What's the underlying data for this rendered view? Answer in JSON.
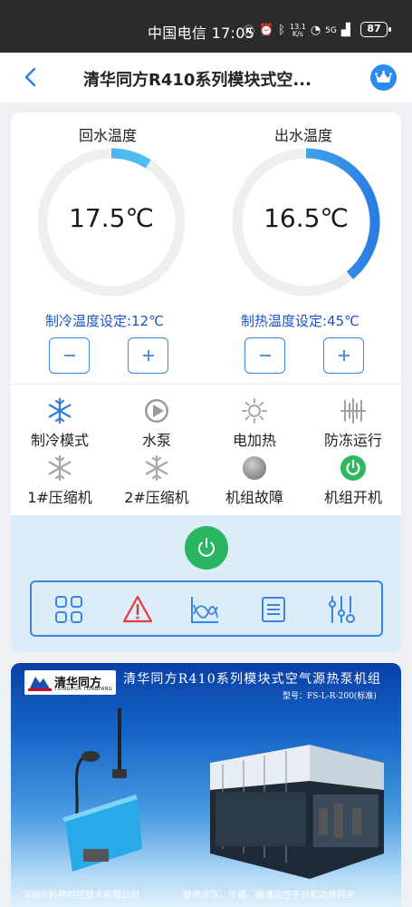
{
  "status_bar": {
    "carrier_time": "中国电信 17:05",
    "net_speed_top": "13.1",
    "net_speed_bottom": "K/s",
    "signal": "5G",
    "battery": "87"
  },
  "nav": {
    "title": "清华同方R410系列模块式空..."
  },
  "gauges": [
    {
      "label": "回水温度",
      "value": "17.5℃",
      "fill_fraction": 0.09
    },
    {
      "label": "出水温度",
      "value": "16.5℃",
      "fill_fraction": 0.39
    }
  ],
  "setpoints": {
    "cooling": "制冷温度设定:12℃",
    "heating": "制热温度设定:45℃"
  },
  "status_items": [
    {
      "label": "制冷模式",
      "icon": "snowflake-icon",
      "active": true
    },
    {
      "label": "水泵",
      "icon": "pump-icon",
      "active": false
    },
    {
      "label": "电加热",
      "icon": "heater-icon",
      "active": false
    },
    {
      "label": "防冻运行",
      "icon": "antifreeze-icon",
      "active": false
    },
    {
      "label": "1#压缩机",
      "icon": "compressor-icon",
      "active": false
    },
    {
      "label": "2#压缩机",
      "icon": "compressor-icon",
      "active": false
    },
    {
      "label": "机组故障",
      "icon": "fault-icon",
      "active": false
    },
    {
      "label": "机组开机",
      "icon": "power-on-icon",
      "active": true
    }
  ],
  "toolbar_icons": [
    "grid-icon",
    "alarm-icon",
    "chart-icon",
    "list-icon",
    "settings-icon"
  ],
  "colors": {
    "accent": "#3a86e0",
    "power_green": "#29b562",
    "setpoint_text": "#1c52c6",
    "alarm_red": "#e23b3b"
  },
  "banner": {
    "logo_text": "清华同方",
    "logo_sub": "TSINGHUA TONGFANG",
    "title": "清华同方R410系列模块式空气源热泵机组",
    "model": "型号：FS-L-R-200(标准)",
    "footer_left": "深圳市科特时控技术有限公司",
    "footer_right": "提供冷冻、冷藏、暖通监控平台和边缘网关"
  }
}
